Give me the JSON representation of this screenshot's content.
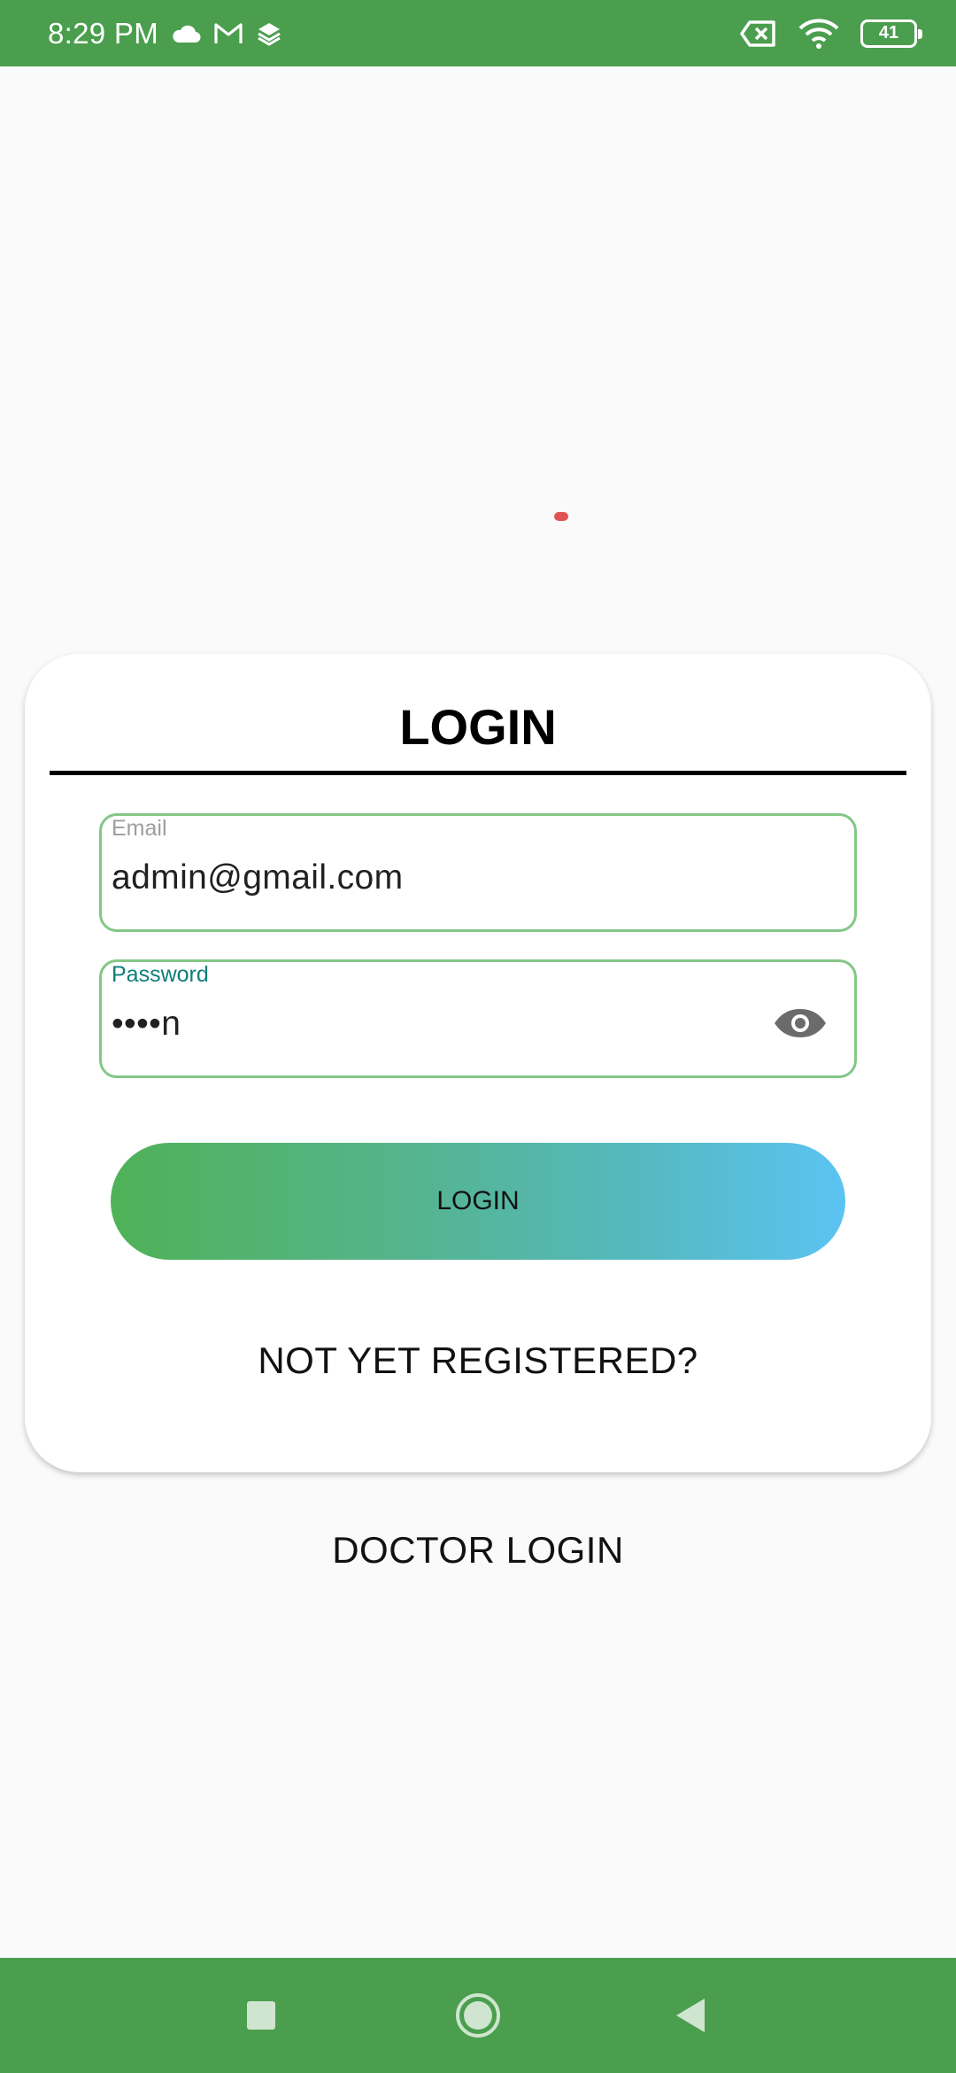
{
  "status_bar": {
    "time": "8:29 PM",
    "notification_icons": [
      "cloud-icon",
      "gmail-icon",
      "layers-icon"
    ],
    "system_icons": [
      "no-sim-icon",
      "wifi-icon",
      "battery-icon"
    ],
    "battery_level": "41",
    "background_color": "#4a9e4d"
  },
  "login_card": {
    "title": "LOGIN",
    "email": {
      "label": "Email",
      "value": "admin@gmail.com"
    },
    "password": {
      "label": "Password",
      "value": "••••n",
      "toggle_icon": "eye-icon"
    },
    "login_button_label": "LOGIN",
    "register_link": "NOT YET REGISTERED?"
  },
  "doctor_login_link": "DOCTOR LOGIN",
  "nav_bar": {
    "buttons": [
      "recents-icon",
      "home-icon",
      "back-icon"
    ],
    "background_color": "#4a9e4d"
  },
  "colors": {
    "accent_green": "#4a9e4d",
    "field_border": "#84c786",
    "password_label": "#0c7f79",
    "button_gradient_start": "#4fb257",
    "button_gradient_end": "#5bc3f2",
    "loading_dot": "#e05353"
  }
}
